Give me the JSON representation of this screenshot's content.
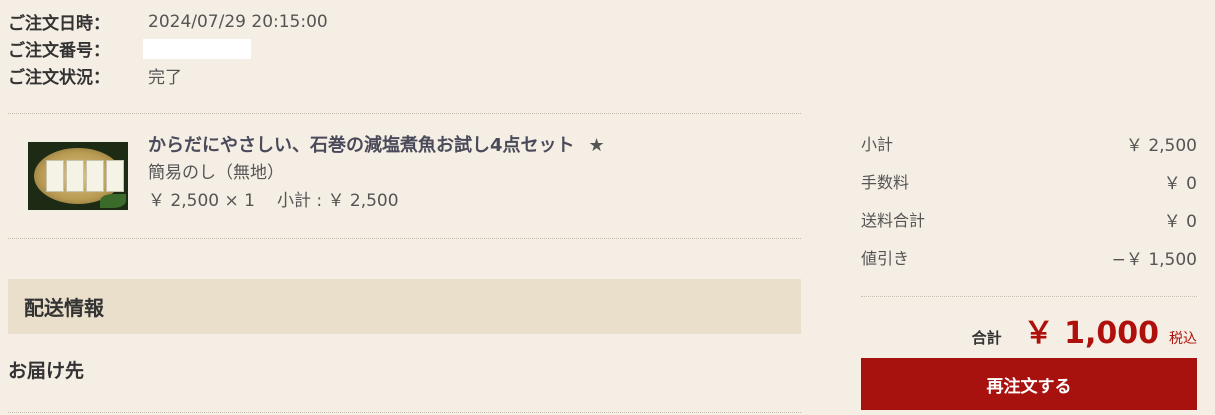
{
  "order": {
    "date_label": "ご注文日時：",
    "date_value": "2024/07/29 20:15:00",
    "number_label": "ご注文番号：",
    "status_label": "ご注文状況：",
    "status_value": "完了"
  },
  "item": {
    "name": "からだにやさしい、石巻の減塩煮魚お試し4点セット",
    "star": "★",
    "option": "簡易のし（無地）",
    "price_qty": "￥ 2,500 × 1",
    "subtotal": "小計 : ￥ 2,500"
  },
  "shipping": {
    "header": "配送情報",
    "destination": "お届け先"
  },
  "summary": {
    "rows": [
      {
        "label": "小計",
        "value": "￥ 2,500"
      },
      {
        "label": "手数料",
        "value": "￥ 0"
      },
      {
        "label": "送料合計",
        "value": "￥ 0"
      },
      {
        "label": "値引き",
        "value": "−￥ 1,500"
      }
    ],
    "total_label": "合計",
    "total_value": "￥ 1,000",
    "tax_note": "税込",
    "reorder_label": "再注文する"
  },
  "colors": {
    "background": "#f4eee4",
    "accent_red": "#b0100c",
    "button_red": "#a8120e",
    "section_header_bg": "#eadfcb"
  }
}
